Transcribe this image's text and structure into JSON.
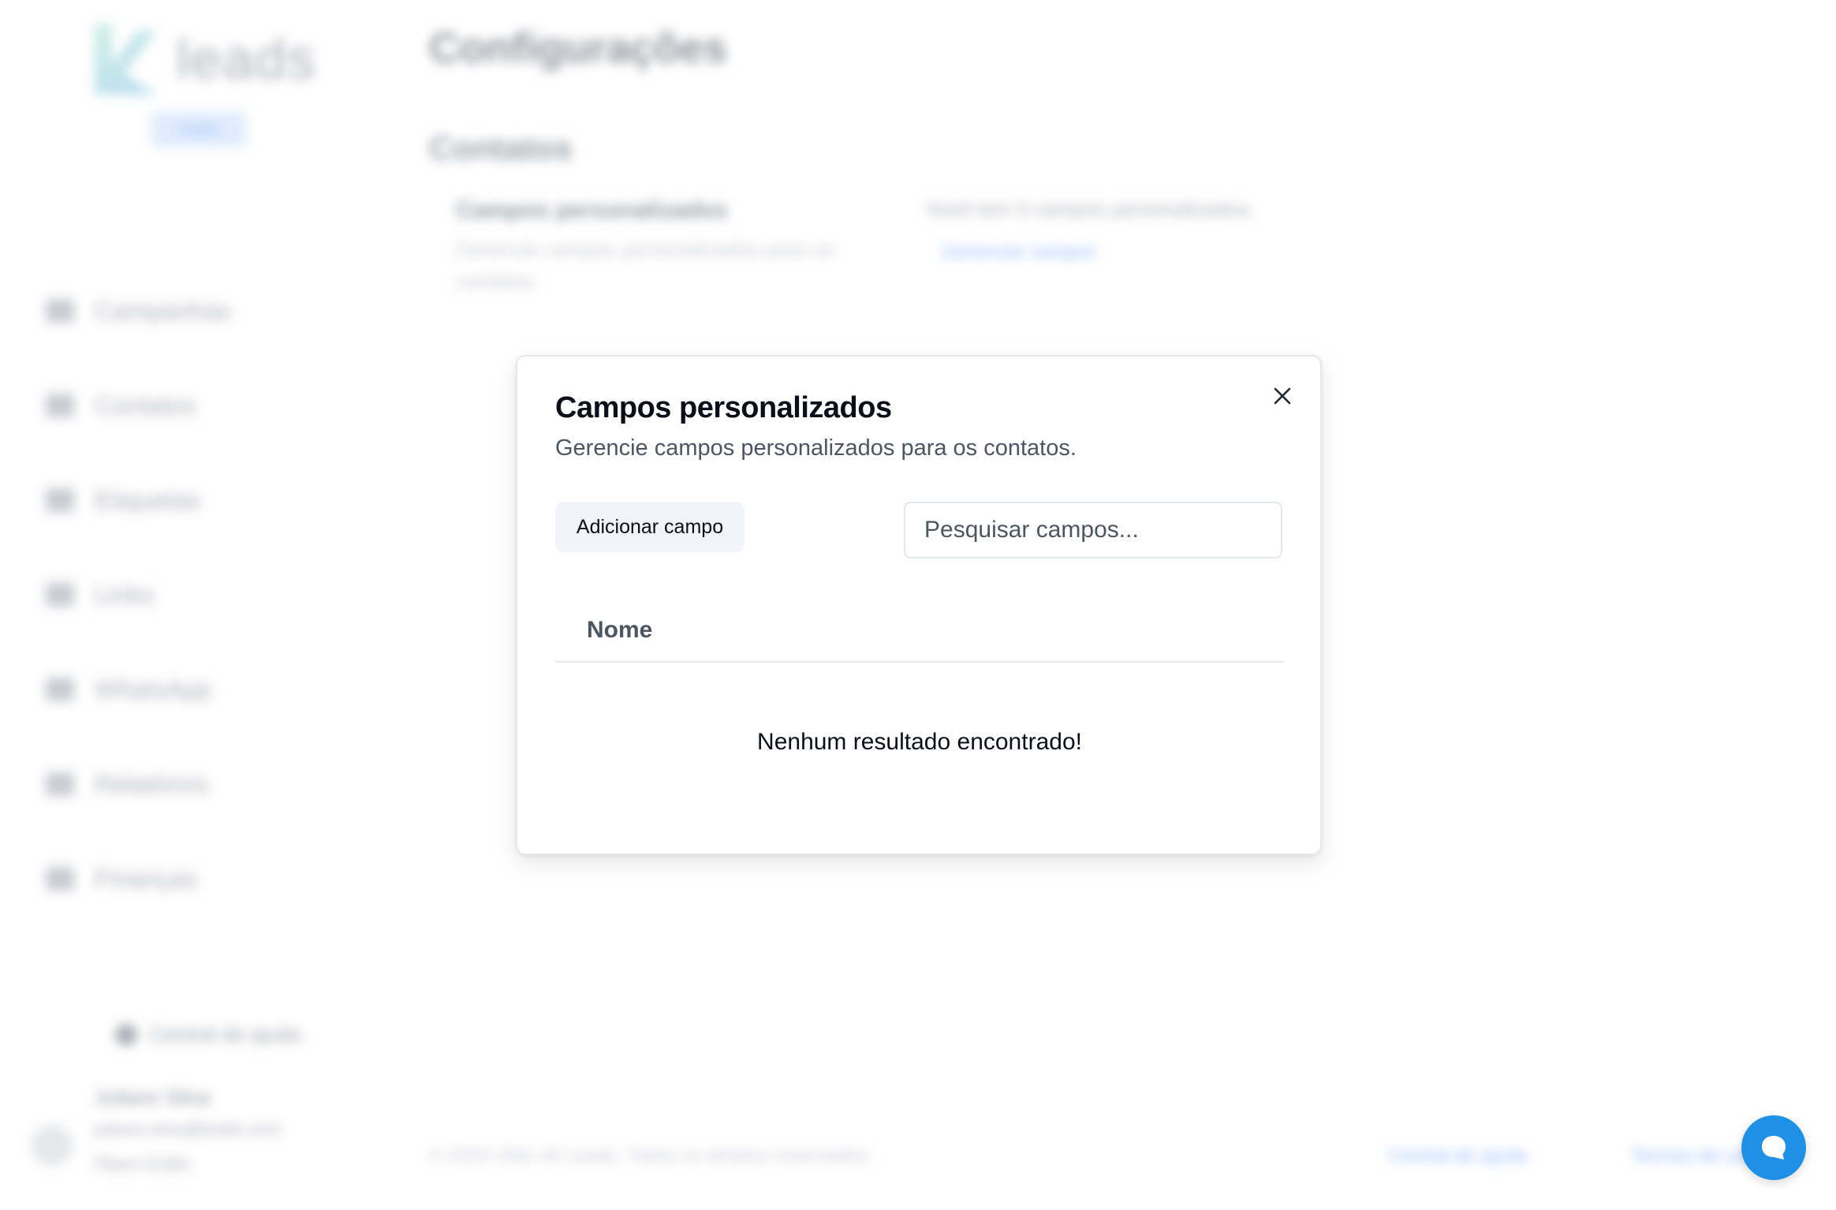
{
  "app": {
    "brand": "leads",
    "plan_badge": "Grátis",
    "nav": [
      {
        "label": "Campanhas",
        "icon": "megaphone-icon"
      },
      {
        "label": "Contatos",
        "icon": "contacts-icon"
      },
      {
        "label": "Etiquetas",
        "icon": "tag-icon"
      },
      {
        "label": "Links",
        "icon": "link-icon"
      },
      {
        "label": "WhatsApp",
        "icon": "whatsapp-icon"
      },
      {
        "label": "Relatórios",
        "icon": "chart-icon"
      },
      {
        "label": "Finanças",
        "icon": "wallet-icon"
      }
    ],
    "help": "Central de ajuda",
    "user": {
      "name": "Juliano Silva",
      "email": "juliano.silva@leads.com",
      "plan": "Plano Grátis"
    }
  },
  "page": {
    "title": "Configurações",
    "section": "Contatos",
    "card_title": "Campos personalizados",
    "card_desc": "Gerencie campos personalizados para os contatos.",
    "card_info": "Você tem 0 campos personalizados.",
    "card_link": "Gerenciar campos"
  },
  "footer": {
    "copyright": "© 2025 Oilà! All Leads. Todos os direitos reservados.",
    "help": "Central de ajuda",
    "terms": "Termos de uso"
  },
  "modal": {
    "title": "Campos personalizados",
    "subtitle": "Gerencie campos personalizados para os contatos.",
    "add_button": "Adicionar campo",
    "search_placeholder": "Pesquisar campos...",
    "search_value": "",
    "columns": [
      "Nome"
    ],
    "empty_message": "Nenhum resultado encontrado!",
    "close_icon": "close-icon"
  },
  "chat": {
    "icon": "chat-bubble-icon",
    "color": "#1e90e6"
  }
}
